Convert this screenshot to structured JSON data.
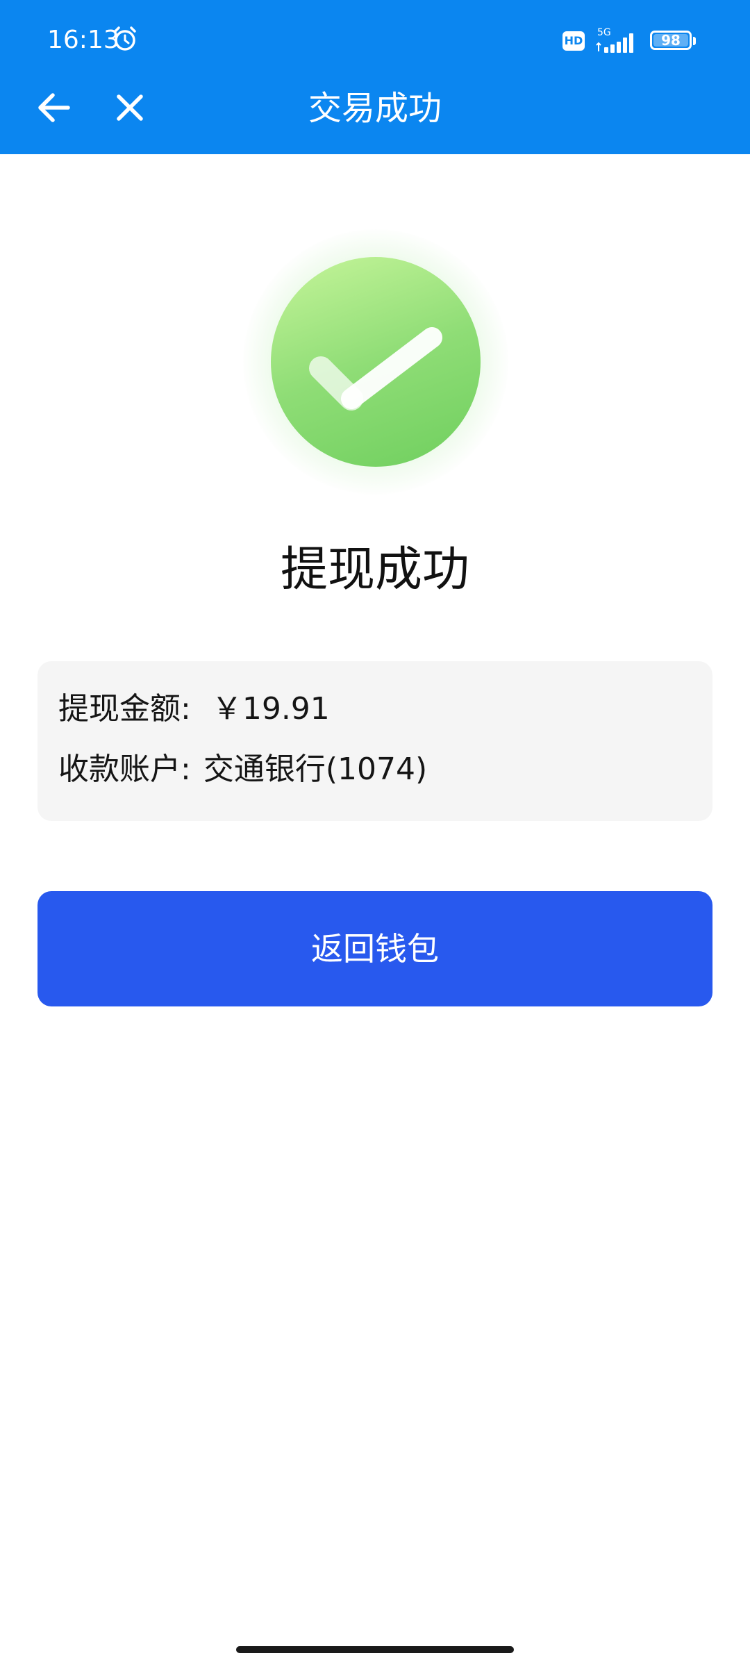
{
  "status_bar": {
    "time": "16:13",
    "network": "5G",
    "hd_label": "HD",
    "battery": "98"
  },
  "header": {
    "title": "交易成功"
  },
  "result": {
    "title": "提现成功"
  },
  "details": {
    "amount_label": "提现金额:",
    "amount_value": "￥19.91",
    "account_label": "收款账户:",
    "account_value": "交通银行(1074)"
  },
  "actions": {
    "return_label": "返回钱包"
  },
  "colors": {
    "header_bg": "#0b86f0",
    "primary_button": "#2859ee",
    "success_green": "#6fcf5e",
    "card_bg": "#f5f5f5"
  },
  "icons": {
    "back": "arrow-left-icon",
    "close": "close-icon",
    "alarm": "alarm-clock-icon",
    "success": "checkmark-icon"
  }
}
